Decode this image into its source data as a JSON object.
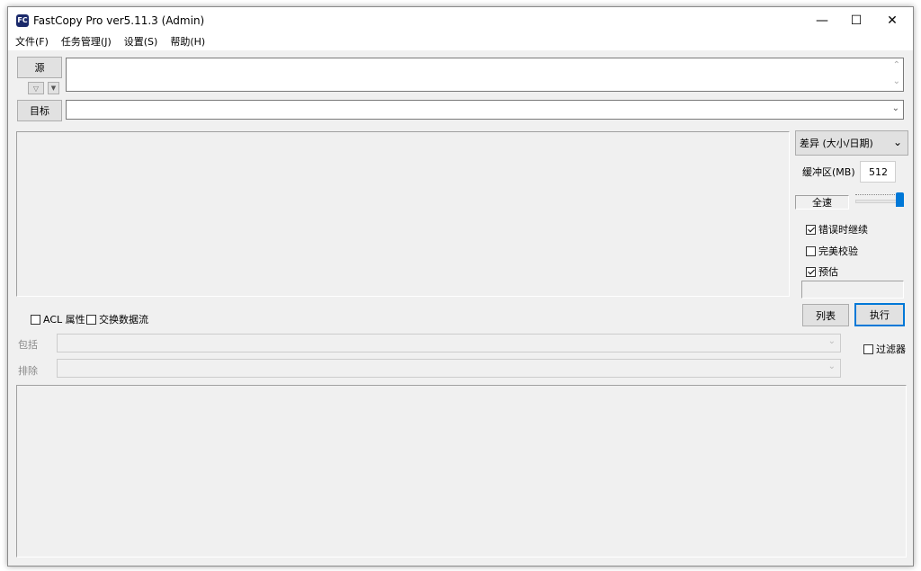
{
  "window": {
    "title": "FastCopy Pro ver5.11.3 (Admin)",
    "app_icon_text": "FC",
    "minimize": "—",
    "maximize": "☐",
    "close": "✕"
  },
  "menu": [
    {
      "label": "文件(F)"
    },
    {
      "label": "任务管理(J)"
    },
    {
      "label": "设置(S)"
    },
    {
      "label": "帮助(H)"
    }
  ],
  "source": {
    "button": "源",
    "value": ""
  },
  "target": {
    "button": "目标",
    "value": ""
  },
  "mode": {
    "selected": "差异 (大小/日期)"
  },
  "buffer": {
    "label": "缓冲区(MB)",
    "value": "512"
  },
  "speed": {
    "label": "全速",
    "level_fraction": 1.0
  },
  "options": {
    "continue_on_error": {
      "label": "错误时继续",
      "checked": true
    },
    "verify": {
      "label": "完美校验",
      "checked": false
    },
    "estimate": {
      "label": "预估",
      "checked": true
    }
  },
  "attributes": {
    "acl": {
      "label": "ACL 属性",
      "checked": false
    },
    "streams": {
      "label": "交换数据流",
      "checked": false
    }
  },
  "buttons": {
    "list": "列表",
    "execute": "执行"
  },
  "filter": {
    "include_label": "包括",
    "exclude_label": "排除",
    "enable_label": "过滤器",
    "enabled": false
  }
}
